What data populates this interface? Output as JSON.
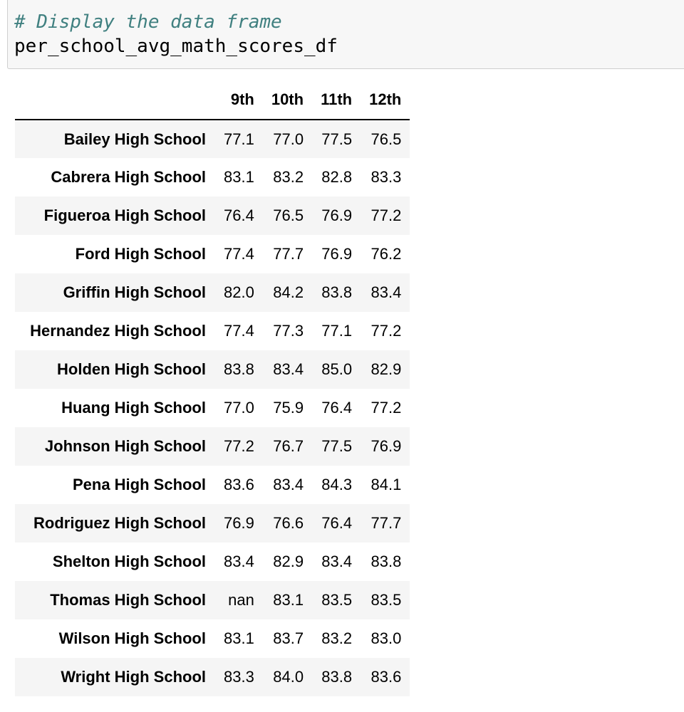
{
  "code_cell": {
    "comment": "# Display the data frame",
    "code": "per_school_avg_math_scores_df"
  },
  "dataframe": {
    "columns": [
      "9th",
      "10th",
      "11th",
      "12th"
    ],
    "rows": [
      {
        "index": "Bailey High School",
        "values": [
          "77.1",
          "77.0",
          "77.5",
          "76.5"
        ]
      },
      {
        "index": "Cabrera High School",
        "values": [
          "83.1",
          "83.2",
          "82.8",
          "83.3"
        ]
      },
      {
        "index": "Figueroa High School",
        "values": [
          "76.4",
          "76.5",
          "76.9",
          "77.2"
        ]
      },
      {
        "index": "Ford High School",
        "values": [
          "77.4",
          "77.7",
          "76.9",
          "76.2"
        ]
      },
      {
        "index": "Griffin High School",
        "values": [
          "82.0",
          "84.2",
          "83.8",
          "83.4"
        ]
      },
      {
        "index": "Hernandez High School",
        "values": [
          "77.4",
          "77.3",
          "77.1",
          "77.2"
        ]
      },
      {
        "index": "Holden High School",
        "values": [
          "83.8",
          "83.4",
          "85.0",
          "82.9"
        ]
      },
      {
        "index": "Huang High School",
        "values": [
          "77.0",
          "75.9",
          "76.4",
          "77.2"
        ]
      },
      {
        "index": "Johnson High School",
        "values": [
          "77.2",
          "76.7",
          "77.5",
          "76.9"
        ]
      },
      {
        "index": "Pena High School",
        "values": [
          "83.6",
          "83.4",
          "84.3",
          "84.1"
        ]
      },
      {
        "index": "Rodriguez High School",
        "values": [
          "76.9",
          "76.6",
          "76.4",
          "77.7"
        ]
      },
      {
        "index": "Shelton High School",
        "values": [
          "83.4",
          "82.9",
          "83.4",
          "83.8"
        ]
      },
      {
        "index": "Thomas High School",
        "values": [
          "nan",
          "83.1",
          "83.5",
          "83.5"
        ]
      },
      {
        "index": "Wilson High School",
        "values": [
          "83.1",
          "83.7",
          "83.2",
          "83.0"
        ]
      },
      {
        "index": "Wright High School",
        "values": [
          "83.3",
          "84.0",
          "83.8",
          "83.6"
        ]
      }
    ]
  },
  "colors": {
    "comment": "#408080",
    "cell_background": "#f7f7f7",
    "cell_border": "#cfcfcf",
    "row_stripe": "#f5f5f5"
  }
}
